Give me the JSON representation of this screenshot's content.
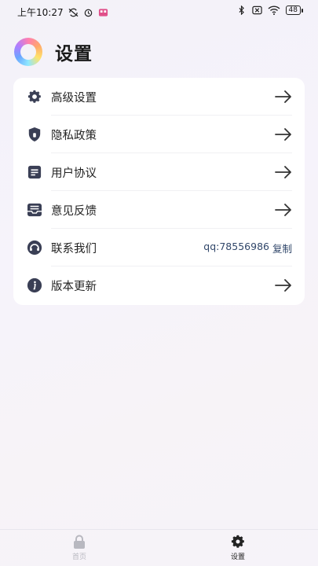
{
  "status_bar": {
    "time": "上午10:27",
    "battery": "48"
  },
  "header": {
    "title": "设置"
  },
  "settings": {
    "items": [
      {
        "label": "高级设置",
        "icon": "gear-icon"
      },
      {
        "label": "隐私政策",
        "icon": "shield-icon"
      },
      {
        "label": "用户协议",
        "icon": "document-icon"
      },
      {
        "label": "意见反馈",
        "icon": "inbox-icon"
      },
      {
        "label": "联系我们",
        "icon": "headset-icon",
        "contact_value": "qq:78556986",
        "copy_label": "复制"
      },
      {
        "label": "版本更新",
        "icon": "info-icon"
      }
    ]
  },
  "tabbar": {
    "home_label": "首页",
    "settings_label": "设置"
  },
  "colors": {
    "accent": "#3a3f55",
    "contact": "#31476a"
  }
}
